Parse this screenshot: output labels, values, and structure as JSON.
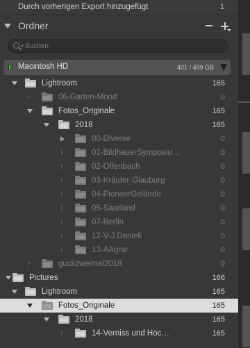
{
  "top_item": {
    "label": "Durch vorherigen Export hinzugefügt",
    "count": "1"
  },
  "panel": {
    "title": "Ordner"
  },
  "search": {
    "placeholder": "Suchen"
  },
  "volume": {
    "name": "Macintosh HD",
    "capacity": "401 / 499 GB",
    "status_color": "#5bd04a"
  },
  "tree": [
    {
      "label": "Lightroom",
      "count": "165",
      "depth": 1,
      "toggle": "down",
      "dim": false,
      "selected": false
    },
    {
      "label": "06-Garten-Mond",
      "count": "0",
      "depth": 2,
      "toggle": "none",
      "dim": true,
      "selected": false
    },
    {
      "label": "Fotos_Originale",
      "count": "165",
      "depth": 2,
      "toggle": "down",
      "dim": false,
      "selected": false
    },
    {
      "label": "2018",
      "count": "165",
      "depth": 3,
      "toggle": "down",
      "dim": false,
      "selected": false
    },
    {
      "label": "00-Diverse",
      "count": "0",
      "depth": 4,
      "toggle": "right",
      "dim": true,
      "selected": false
    },
    {
      "label": "01-BildhauerSymposiu…",
      "count": "0",
      "depth": 4,
      "toggle": "none",
      "dim": true,
      "selected": false
    },
    {
      "label": "02-Offenbach",
      "count": "0",
      "depth": 4,
      "toggle": "none",
      "dim": true,
      "selected": false
    },
    {
      "label": "03-Kräuter-Glauburg",
      "count": "0",
      "depth": 4,
      "toggle": "none",
      "dim": true,
      "selected": false
    },
    {
      "label": "04-PioneerGelände",
      "count": "0",
      "depth": 4,
      "toggle": "none",
      "dim": true,
      "selected": false
    },
    {
      "label": "05-Saarland",
      "count": "0",
      "depth": 4,
      "toggle": "none",
      "dim": true,
      "selected": false
    },
    {
      "label": "07-Berlin",
      "count": "0",
      "depth": 4,
      "toggle": "none",
      "dim": true,
      "selected": false
    },
    {
      "label": "12-V-J.Daniek",
      "count": "0",
      "depth": 4,
      "toggle": "none",
      "dim": true,
      "selected": false
    },
    {
      "label": "13-AAgrar",
      "count": "0",
      "depth": 4,
      "toggle": "none",
      "dim": true,
      "selected": false
    },
    {
      "label": "guckzweimal2018",
      "count": "0",
      "depth": 2,
      "toggle": "none",
      "dim": true,
      "selected": false
    },
    {
      "label": "Pictures",
      "count": "166",
      "depth": 0,
      "toggle": "down",
      "dim": false,
      "selected": false
    },
    {
      "label": "Lightroom",
      "count": "165",
      "depth": 1,
      "toggle": "down",
      "dim": false,
      "selected": false
    },
    {
      "label": "Fotos_Originale",
      "count": "165",
      "depth": 2,
      "toggle": "down",
      "dim": false,
      "selected": true
    },
    {
      "label": "2018",
      "count": "165",
      "depth": 3,
      "toggle": "down",
      "dim": false,
      "selected": false
    },
    {
      "label": "14-Verniss und Hoc…",
      "count": "165",
      "depth": 4,
      "toggle": "none",
      "dim": false,
      "selected": false
    }
  ]
}
